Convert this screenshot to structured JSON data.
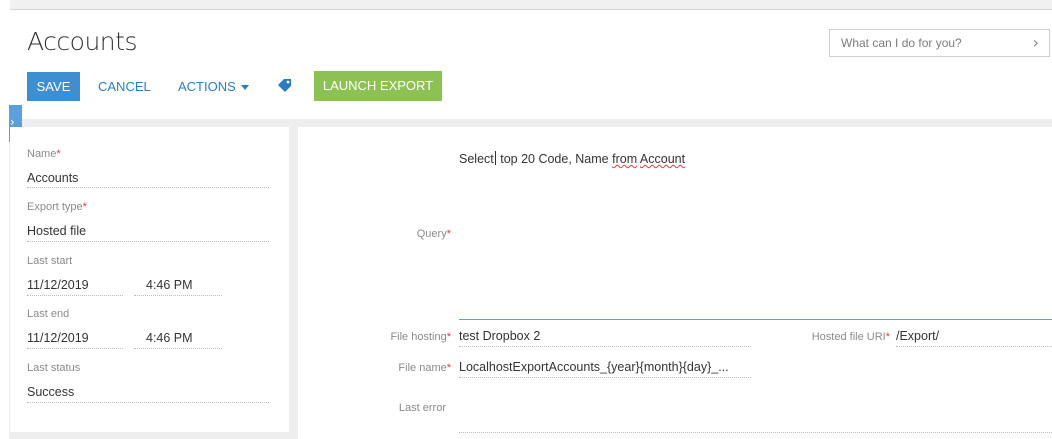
{
  "page": {
    "title": "Accounts"
  },
  "search": {
    "placeholder": "What can I do for you?"
  },
  "toolbar": {
    "save_label": "SAVE",
    "cancel_label": "CANCEL",
    "actions_label": "ACTIONS",
    "launch_label": "LAUNCH EXPORT"
  },
  "left_fields": {
    "name": {
      "label": "Name",
      "value": "Accounts"
    },
    "export_type": {
      "label": "Export type",
      "value": "Hosted file"
    },
    "last_start": {
      "label": "Last start",
      "date": "11/12/2019",
      "time": "4:46 PM"
    },
    "last_end": {
      "label": "Last end",
      "date": "11/12/2019",
      "time": "4:46 PM"
    },
    "last_status": {
      "label": "Last status",
      "value": "Success"
    }
  },
  "right_fields": {
    "query": {
      "label": "Query",
      "text_part1": "Select",
      "text_part2": " top 20 Code, Name ",
      "text_part3": "from",
      "text_part4": "Account"
    },
    "file_hosting": {
      "label": "File hosting",
      "value": "test Dropbox 2"
    },
    "hosted_file_uri": {
      "label": "Hosted file URI",
      "value": "/Export/"
    },
    "file_name": {
      "label": "File name",
      "value": "LocalhostExportAccounts_{year}{month}{day}_..."
    },
    "last_error": {
      "label": "Last error",
      "value": ""
    }
  },
  "colors": {
    "primary_button": "#3d8fd1",
    "launch_button": "#8dc153",
    "link": "#2b7cc7",
    "required": "#e5393d"
  },
  "icons": {
    "tag": "tag-icon",
    "search_go": "chevron-right-icon",
    "side_toggle": "chevron-right-icon"
  }
}
